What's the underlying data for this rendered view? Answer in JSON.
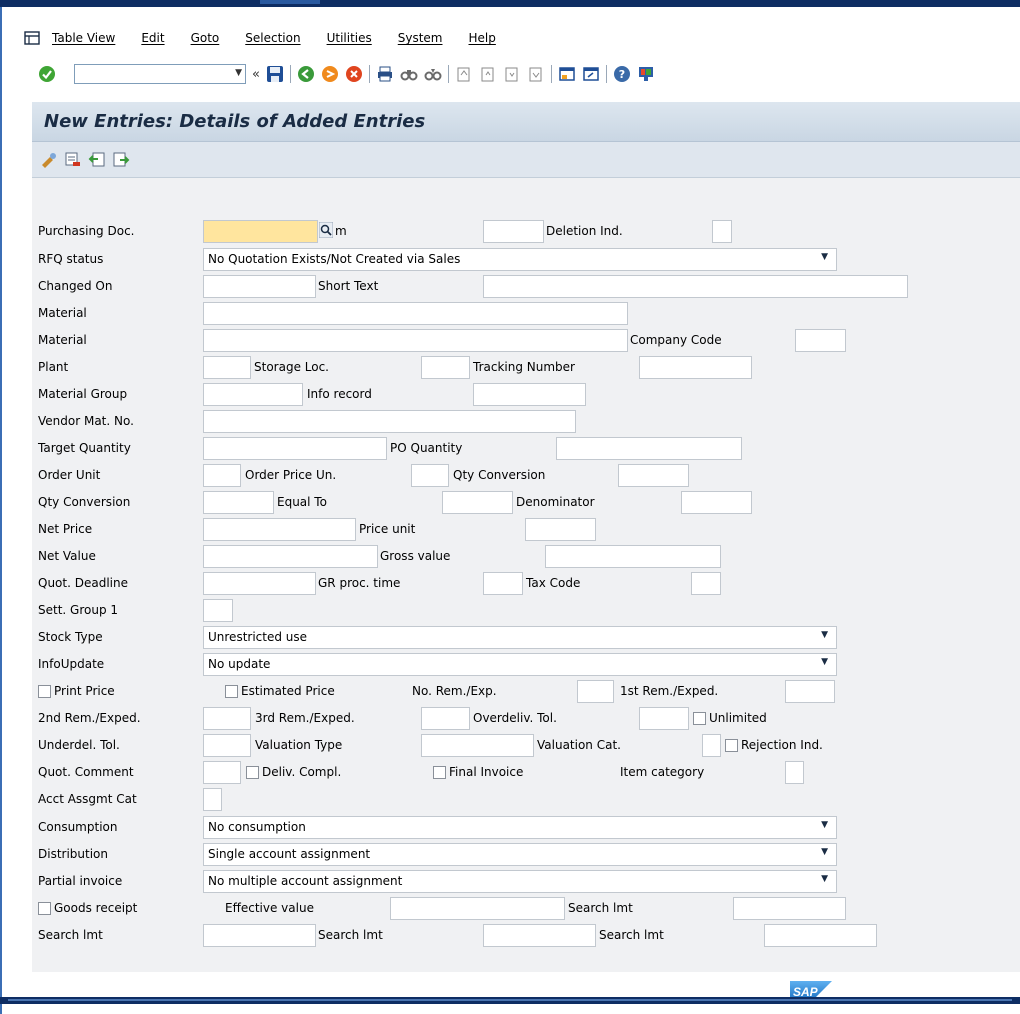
{
  "menu": [
    "Table View",
    "Edit",
    "Goto",
    "Selection",
    "Utilities",
    "System",
    "Help"
  ],
  "toolbar": {
    "command_field_value": "",
    "icons": [
      "enter-icon",
      "save-icon",
      "back-icon",
      "exit-icon",
      "cancel-icon",
      "print-icon",
      "find-icon",
      "find-next-icon",
      "first-page-icon",
      "previous-page-icon",
      "next-page-icon",
      "last-page-icon",
      "create-session-icon",
      "shortcut-icon",
      "help-icon",
      "customize-layout-icon"
    ]
  },
  "page": {
    "title": "New Entries: Details of Added Entries"
  },
  "app_toolbar": {
    "icons": [
      "change-display-icon",
      "delete-icon",
      "previous-entry-icon",
      "next-entry-icon"
    ]
  },
  "labels": {
    "purchasing_doc": "Purchasing Doc.",
    "m": "m",
    "deletion_ind": "Deletion Ind.",
    "rfq_status": "RFQ status",
    "changed_on": "Changed On",
    "short_text": "Short Text",
    "material1": "Material",
    "material2": "Material",
    "company_code": "Company Code",
    "plant": "Plant",
    "storage_loc": "Storage Loc.",
    "tracking_number": "Tracking Number",
    "material_group": "Material Group",
    "info_record": "Info record",
    "vendor_mat_no": "Vendor Mat. No.",
    "target_quantity": "Target Quantity",
    "po_quantity": "PO Quantity",
    "order_unit": "Order Unit",
    "order_price_un": "Order Price Un.",
    "qty_conversion1": "Qty Conversion",
    "qty_conversion2": "Qty Conversion",
    "equal_to": "Equal To",
    "denominator": "Denominator",
    "net_price": "Net Price",
    "price_unit": "Price unit",
    "net_value": "Net Value",
    "gross_value": "Gross value",
    "quot_deadline": "Quot. Deadline",
    "gr_proc_time": "GR proc. time",
    "tax_code": "Tax Code",
    "sett_group_1": "Sett. Group 1",
    "stock_type": "Stock Type",
    "info_update": "InfoUpdate",
    "print_price": "Print Price",
    "estimated_price": "Estimated Price",
    "no_rem_exp": "No. Rem./Exp.",
    "first_rem_exped": "1st Rem./Exped.",
    "second_rem_exped": "2nd Rem./Exped.",
    "third_rem_exped": "3rd Rem./Exped.",
    "overdeliv_tol": "Overdeliv. Tol.",
    "unlimited": "Unlimited",
    "underdel_tol": "Underdel. Tol.",
    "valuation_type": "Valuation Type",
    "valuation_cat": "Valuation Cat.",
    "rejection_ind": "Rejection Ind.",
    "quot_comment": "Quot. Comment",
    "deliv_compl": "Deliv. Compl.",
    "final_invoice": "Final Invoice",
    "item_category": "Item category",
    "acct_assgmt_cat": "Acct Assgmt Cat",
    "consumption": "Consumption",
    "distribution": "Distribution",
    "partial_invoice": "Partial invoice",
    "goods_receipt": "Goods receipt",
    "effective_value": "Effective value",
    "search_lmt_a": "Search lmt",
    "search_lmt_b": "Search lmt",
    "search_lmt_c": "Search lmt",
    "search_lmt_d": "Search lmt"
  },
  "dropdowns": {
    "rfq_status": "No Quotation Exists/Not Created via Sales",
    "stock_type": "Unrestricted use",
    "info_update": "No update",
    "consumption": "No consumption",
    "distribution": "Single account assignment",
    "partial_invoice": "No multiple account assignment"
  },
  "checkboxes": {
    "print_price": false,
    "estimated_price": false,
    "unlimited": false,
    "rejection_ind": false,
    "deliv_compl": false,
    "final_invoice": false,
    "goods_receipt": false
  },
  "branding": {
    "logo_text": "SAP"
  },
  "colors": {
    "title_text": "#1a2c44",
    "active_field": "#ffe59e",
    "content_bg": "#f0f1f3",
    "frame_blue": "#0e2d63"
  }
}
